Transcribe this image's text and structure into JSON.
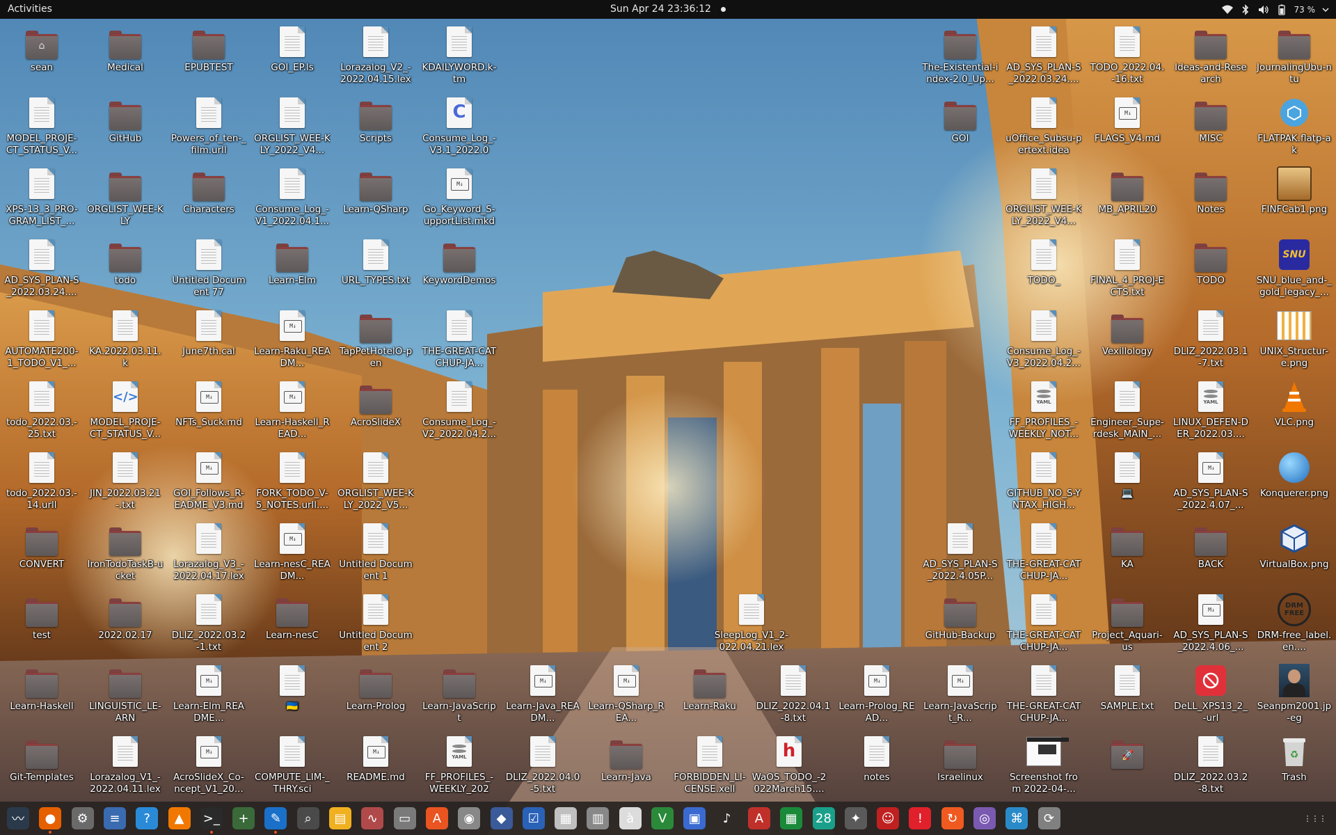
{
  "topbar": {
    "activities": "Activities",
    "clock": "Sun Apr 24  23:36:12",
    "battery": "73 %",
    "tray_icons": [
      "wifi-icon",
      "bluetooth-icon",
      "volume-icon",
      "battery-icon",
      "power-menu-icon"
    ]
  },
  "desktop": {
    "items": [
      {
        "label": "sean",
        "kind": "folder",
        "emblem": "home-icon"
      },
      {
        "label": "Medical",
        "kind": "folder"
      },
      {
        "label": "EPUBTEST",
        "kind": "folder"
      },
      {
        "label": "GOI_EP.ls",
        "kind": "doc"
      },
      {
        "label": "Lorazalog_V2_-2022.04.15.lex",
        "kind": "doc"
      },
      {
        "label": "KDAILYWORD.k-tm",
        "kind": "doc"
      },
      {
        "label": "MODEL_PROJE-CT_STATUS_V...",
        "kind": "doc"
      },
      {
        "label": "GitHub",
        "kind": "folder"
      },
      {
        "label": "Powers_of_ten-_film.urll",
        "kind": "doc"
      },
      {
        "label": "ORGLIST_WEE-KLY_2022_V4...",
        "kind": "doc"
      },
      {
        "label": "Scripts",
        "kind": "folder"
      },
      {
        "label": "Consume_Log_-V3.1_2022.04....",
        "kind": "c-source"
      },
      {
        "label": "XPS-13_3_PRO-GRAM_LIST_...",
        "kind": "doc"
      },
      {
        "label": "ORGLIST_WEE-KLY",
        "kind": "folder"
      },
      {
        "label": "Characters",
        "kind": "folder"
      },
      {
        "label": "Consume_Log_-V1_2022.04.1...",
        "kind": "doc"
      },
      {
        "label": "Learn-QSharp",
        "kind": "folder"
      },
      {
        "label": "Go_Keyword_S-upportList.mkd",
        "kind": "md"
      },
      {
        "label": "AD_SYS_PLAN-S_2022.03.24....",
        "kind": "doc"
      },
      {
        "label": "todo",
        "kind": "folder"
      },
      {
        "label": "Untitled Document 77",
        "kind": "doc"
      },
      {
        "label": "Learn-Elm",
        "kind": "folder"
      },
      {
        "label": "URL_TYPES.txt",
        "kind": "doc"
      },
      {
        "label": "KeywordDemos",
        "kind": "folder"
      },
      {
        "label": "AUTOMATE200-1_TODO_V1_...",
        "kind": "doc"
      },
      {
        "label": "KA.2022.03.11.k",
        "kind": "doc"
      },
      {
        "label": "June7th.cal",
        "kind": "doc"
      },
      {
        "label": "Learn-Raku_READM...",
        "kind": "md"
      },
      {
        "label": "TapPetHotelO-pen",
        "kind": "folder"
      },
      {
        "label": "THE-GREAT-CATCHUP-JA...",
        "kind": "doc"
      },
      {
        "label": "todo_2022.03.-25.txt",
        "kind": "doc"
      },
      {
        "label": "MODEL_PROJE-CT_STATUS_V...",
        "kind": "html"
      },
      {
        "label": "NFTs_Suck.md",
        "kind": "md"
      },
      {
        "label": "Learn-Haskell_READ...",
        "kind": "md"
      },
      {
        "label": "AcroSlideX",
        "kind": "folder"
      },
      {
        "label": "Consume_Log_-V2_2022.04.2...",
        "kind": "doc"
      },
      {
        "label": "todo_2022.03.-14.urll",
        "kind": "doc"
      },
      {
        "label": "JIN_2022.03.21-.txt",
        "kind": "doc"
      },
      {
        "label": "GOI_Follows_R-EADME_V3.md",
        "kind": "md"
      },
      {
        "label": "FORK_TODO_V-5_NOTES.urll....",
        "kind": "doc"
      },
      {
        "label": "ORGLIST_WEE-KLY_2022_V5...",
        "kind": "doc"
      },
      {
        "label": "CONVERT",
        "kind": "folder"
      },
      {
        "label": "IronTodoTaskB-ucket",
        "kind": "folder"
      },
      {
        "label": "Lorazalog_V3_-2022.04.17.lex",
        "kind": "doc"
      },
      {
        "label": "Learn-nesC_READM...",
        "kind": "md"
      },
      {
        "label": "Untitled Document 1",
        "kind": "doc"
      },
      {
        "label": "test",
        "kind": "folder"
      },
      {
        "label": "2022.02.17",
        "kind": "folder"
      },
      {
        "label": "DLIZ_2022.03.2-1.txt",
        "kind": "doc"
      },
      {
        "label": "Learn-nesC",
        "kind": "folder"
      },
      {
        "label": "Untitled Document 2",
        "kind": "doc"
      },
      {
        "label": "SleepLog_V1_2-022.04.21.lex",
        "kind": "doc"
      },
      {
        "label": "Learn-Haskell",
        "kind": "folder"
      },
      {
        "label": "LINGUISTIC_LE-ARN",
        "kind": "folder"
      },
      {
        "label": "Learn-Elm_README...",
        "kind": "md"
      },
      {
        "label": "🇺🇦",
        "kind": "doc"
      },
      {
        "label": "Learn-Prolog",
        "kind": "folder"
      },
      {
        "label": "Learn-JavaScript",
        "kind": "folder"
      },
      {
        "label": "Learn-Java_READM...",
        "kind": "md"
      },
      {
        "label": "Learn-QSharp_REA...",
        "kind": "md"
      },
      {
        "label": "Learn-Raku",
        "kind": "folder"
      },
      {
        "label": "DLIZ_2022.04.1-8.txt",
        "kind": "doc"
      },
      {
        "label": "Learn-Prolog_READ...",
        "kind": "md"
      },
      {
        "label": "Learn-JavaScript_R...",
        "kind": "md"
      },
      {
        "label": "Git-Templates",
        "kind": "folder"
      },
      {
        "label": "Lorazalog_V1_-2022.04.11.lex",
        "kind": "doc"
      },
      {
        "label": "AcroSlideX_Co-ncept_V1_20...",
        "kind": "md"
      },
      {
        "label": "COMPUTE_LIM-_THRY.sci",
        "kind": "doc"
      },
      {
        "label": "README.md",
        "kind": "md"
      },
      {
        "label": "FF_PROFILES_-WEEKLY_2022....",
        "kind": "yaml"
      },
      {
        "label": "DLIZ_2022.04.0-5.txt",
        "kind": "doc"
      },
      {
        "label": "Learn-Java",
        "kind": "folder"
      },
      {
        "label": "FORBIDDEN_LI-CENSE.xell",
        "kind": "doc"
      },
      {
        "label": "WaOS_TODO_-2022March15....",
        "kind": "h-doc"
      },
      {
        "label": "notes",
        "kind": "doc"
      },
      {
        "label": "Israelinux",
        "kind": "folder"
      },
      {
        "label": "Screenshot from 2022-04-...",
        "kind": "screenshot"
      },
      {
        "label": "",
        "kind": "folder",
        "emblem": "rocket-icon"
      },
      {
        "label": "DLIZ_2022.03.2-8.txt",
        "kind": "doc"
      },
      {
        "label": "Trash",
        "kind": "trash"
      },
      {
        "label": "The-Existential-index-2.0_Up...",
        "kind": "folder"
      },
      {
        "label": "AD_SYS_PLAN-S_2022.03.24....",
        "kind": "doc"
      },
      {
        "label": "TODO_2022.04.-16.txt",
        "kind": "doc"
      },
      {
        "label": "Ideas-and-Research",
        "kind": "folder"
      },
      {
        "label": "JournalingUbu-ntu",
        "kind": "folder"
      },
      {
        "label": "GOI",
        "kind": "folder"
      },
      {
        "label": "uOffice_Subsu-pertext.idea",
        "kind": "doc"
      },
      {
        "label": "FLAGS_V4.md",
        "kind": "md"
      },
      {
        "label": "MISC",
        "kind": "folder"
      },
      {
        "label": "FLATPAK.flatp-ak",
        "kind": "flatpak"
      },
      {
        "label": "ORGLIST_WEE-KLY_2022_V4...",
        "kind": "doc"
      },
      {
        "label": "MB_APRIL20",
        "kind": "folder"
      },
      {
        "label": "Notes",
        "kind": "folder"
      },
      {
        "label": "FINFCab1.png",
        "kind": "image-cabinet"
      },
      {
        "label": "TODO_",
        "kind": "doc"
      },
      {
        "label": "FINAL_4_PROJ-ECTS.txt",
        "kind": "doc"
      },
      {
        "label": "TODO",
        "kind": "folder"
      },
      {
        "label": "SNU_blue_and-_gold_legacy_...",
        "kind": "image-snu"
      },
      {
        "label": "Consume_Log_-V3_2022.04.2...",
        "kind": "doc"
      },
      {
        "label": "Vexillology",
        "kind": "folder"
      },
      {
        "label": "DLIZ_2022.03.1-7.txt",
        "kind": "doc"
      },
      {
        "label": "UNIX_Structur-e.png",
        "kind": "image-unix"
      },
      {
        "label": "FF_PROFILES_-WEEKLY_NOT...",
        "kind": "yaml"
      },
      {
        "label": "Engineer_Supe-rdesk_MAIN_...",
        "kind": "doc"
      },
      {
        "label": "LINUX_DEFEN-DER_2022.03....",
        "kind": "yaml"
      },
      {
        "label": "VLC.png",
        "kind": "image-vlc"
      },
      {
        "label": "GITHUB_NO_S-YNTAX_HIGH...",
        "kind": "doc"
      },
      {
        "label": "💻",
        "kind": "doc"
      },
      {
        "label": "AD_SYS_PLAN-S_2022.4.07_...",
        "kind": "md"
      },
      {
        "label": "Konquerer.png",
        "kind": "image-konq"
      },
      {
        "label": "AD_SYS_PLAN-S_2022.4.05P...",
        "kind": "doc"
      },
      {
        "label": "THE-GREAT-CATCHUP-JA...",
        "kind": "doc"
      },
      {
        "label": "KA",
        "kind": "folder"
      },
      {
        "label": "BACK",
        "kind": "folder"
      },
      {
        "label": "VirtualBox.png",
        "kind": "image-vbox"
      },
      {
        "label": "GitHub-Backup",
        "kind": "folder"
      },
      {
        "label": "THE-GREAT-CATCHUP-JA...",
        "kind": "doc"
      },
      {
        "label": "Project_Aquari-us",
        "kind": "folder"
      },
      {
        "label": "AD_SYS_PLAN-S_2022.4.06_...",
        "kind": "md"
      },
      {
        "label": "DRM-free_label.en....",
        "kind": "image-drm"
      },
      {
        "label": "THE-GREAT-CATCHUP-JA...",
        "kind": "doc"
      },
      {
        "label": "SAMPLE.txt",
        "kind": "doc"
      },
      {
        "label": "DeLL_XPS13_2_-url",
        "kind": "red-stop"
      },
      {
        "label": "Seanpm2001.jp-eg",
        "kind": "image-photo"
      }
    ]
  },
  "dock": {
    "apps": [
      {
        "name": "system-monitor-icon",
        "glyph": "〰",
        "running": false
      },
      {
        "name": "firefox-icon",
        "glyph": "●",
        "running": true
      },
      {
        "name": "settings-icon",
        "glyph": "⚙",
        "running": false
      },
      {
        "name": "text-document-icon",
        "glyph": "≡",
        "running": false
      },
      {
        "name": "help-icon",
        "glyph": "?",
        "running": false
      },
      {
        "name": "vlc-icon",
        "glyph": "▲",
        "running": false
      },
      {
        "name": "terminal-icon",
        "glyph": ">_",
        "running": true
      },
      {
        "name": "new-tab-icon",
        "glyph": "+",
        "running": false
      },
      {
        "name": "text-editor-icon",
        "glyph": "✎",
        "running": true
      },
      {
        "name": "image-viewer-icon",
        "glyph": "⌕",
        "running": false
      },
      {
        "name": "office-writer-icon",
        "glyph": "▤",
        "running": false
      },
      {
        "name": "waveform-icon",
        "glyph": "∿",
        "running": false
      },
      {
        "name": "files-icon",
        "glyph": "▭",
        "running": false
      },
      {
        "name": "software-store-icon",
        "glyph": "A",
        "running": false
      },
      {
        "name": "disc-burner-icon",
        "glyph": "◉",
        "running": false
      },
      {
        "name": "web-browser-icon",
        "glyph": "◆",
        "running": false
      },
      {
        "name": "todo-list-icon",
        "glyph": "☑",
        "running": false
      },
      {
        "name": "document-viewer-icon",
        "glyph": "▦",
        "running": false
      },
      {
        "name": "archive-manager-icon",
        "glyph": "▥",
        "running": false
      },
      {
        "name": "character-map-icon",
        "glyph": "à",
        "running": false
      },
      {
        "name": "vim-icon",
        "glyph": "V",
        "running": false
      },
      {
        "name": "screen-share-icon",
        "glyph": "▣",
        "running": false
      },
      {
        "name": "music-icon",
        "glyph": "♪",
        "running": false
      },
      {
        "name": "pdf-viewer-icon",
        "glyph": "A",
        "running": false
      },
      {
        "name": "spreadsheet-icon",
        "glyph": "▦",
        "running": false
      },
      {
        "name": "calendar-icon",
        "glyph": "28",
        "running": false
      },
      {
        "name": "games-icon",
        "glyph": "✦",
        "running": false
      },
      {
        "name": "mario-icon",
        "glyph": "☺",
        "running": false
      },
      {
        "name": "alert-icon",
        "glyph": "!",
        "running": false
      },
      {
        "name": "backup-icon",
        "glyph": "↻",
        "running": false
      },
      {
        "name": "disk-icon",
        "glyph": "◎",
        "running": false
      },
      {
        "name": "weather-icon",
        "glyph": "⌘",
        "running": false
      },
      {
        "name": "updater-icon",
        "glyph": "⟳",
        "running": false
      },
      {
        "name": "show-applications-icon",
        "glyph": "⋮⋮⋮",
        "running": false
      }
    ]
  }
}
